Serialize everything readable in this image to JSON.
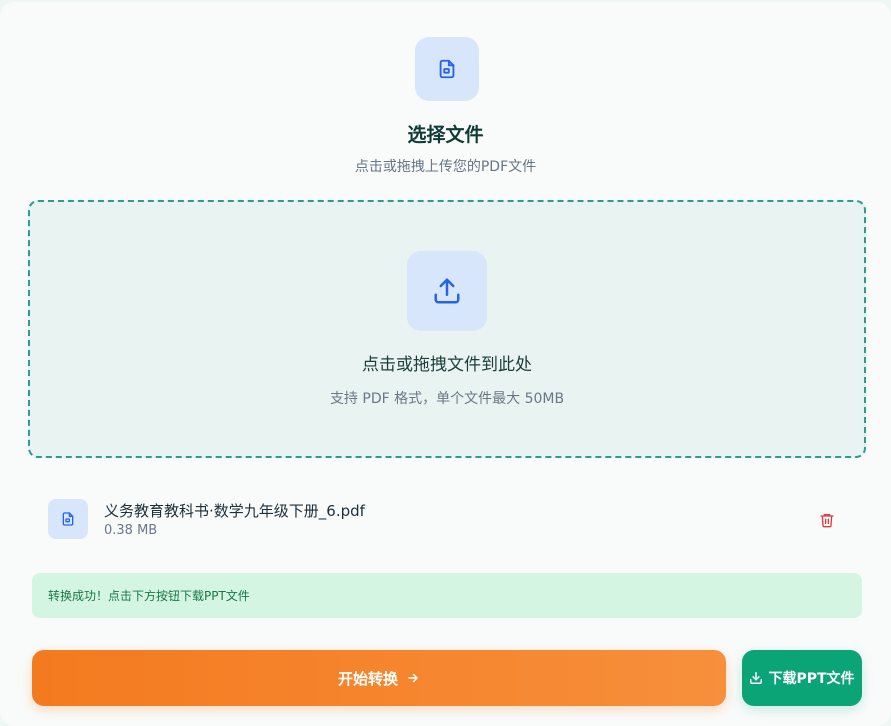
{
  "header": {
    "icon": "file-icon",
    "title": "选择文件",
    "subtitle": "点击或拖拽上传您的PDF文件"
  },
  "dropzone": {
    "icon": "upload-icon",
    "title": "点击或拖拽文件到此处",
    "hint": "支持 PDF 格式，单个文件最大 50MB"
  },
  "file": {
    "icon": "file-icon",
    "name": "义务教育教科书·数学九年级下册_6.pdf",
    "size": "0.38 MB",
    "delete_icon": "trash-icon"
  },
  "alert": {
    "message": "转换成功！点击下方按钮下载PPT文件"
  },
  "actions": {
    "convert_label": "开始转换",
    "convert_icon": "arrow-right-icon",
    "download_label": "下载PPT文件",
    "download_icon": "download-icon"
  },
  "colors": {
    "accent_orange": "#f47a1f",
    "accent_green": "#0ba476",
    "icon_blue": "#2563eb",
    "delete_red": "#e03a3a"
  }
}
